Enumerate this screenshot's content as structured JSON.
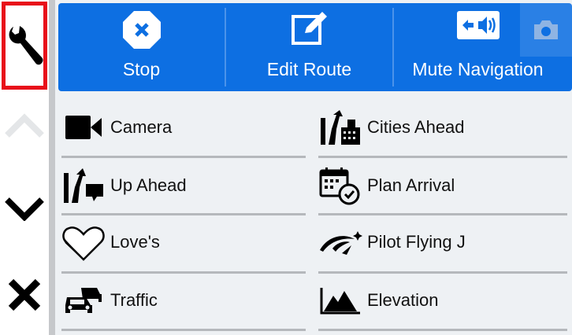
{
  "top_bar": {
    "stop_label": "Stop",
    "edit_route_label": "Edit Route",
    "mute_label": "Mute Navigation"
  },
  "menu": {
    "items": [
      {
        "label": "Camera",
        "icon": "video-camera-icon"
      },
      {
        "label": "Cities Ahead",
        "icon": "cities-ahead-icon"
      },
      {
        "label": "Up Ahead",
        "icon": "up-ahead-icon"
      },
      {
        "label": "Plan Arrival",
        "icon": "calendar-clock-icon"
      },
      {
        "label": "Love's",
        "icon": "loves-heart-icon"
      },
      {
        "label": "Pilot Flying J",
        "icon": "pilot-flying-j-icon"
      },
      {
        "label": "Traffic",
        "icon": "traffic-cars-icon"
      },
      {
        "label": "Elevation",
        "icon": "elevation-chart-icon"
      }
    ]
  },
  "colors": {
    "accent_blue": "#0d6fe2",
    "highlight_red": "#e8101a",
    "panel_bg": "#eef1f4"
  }
}
